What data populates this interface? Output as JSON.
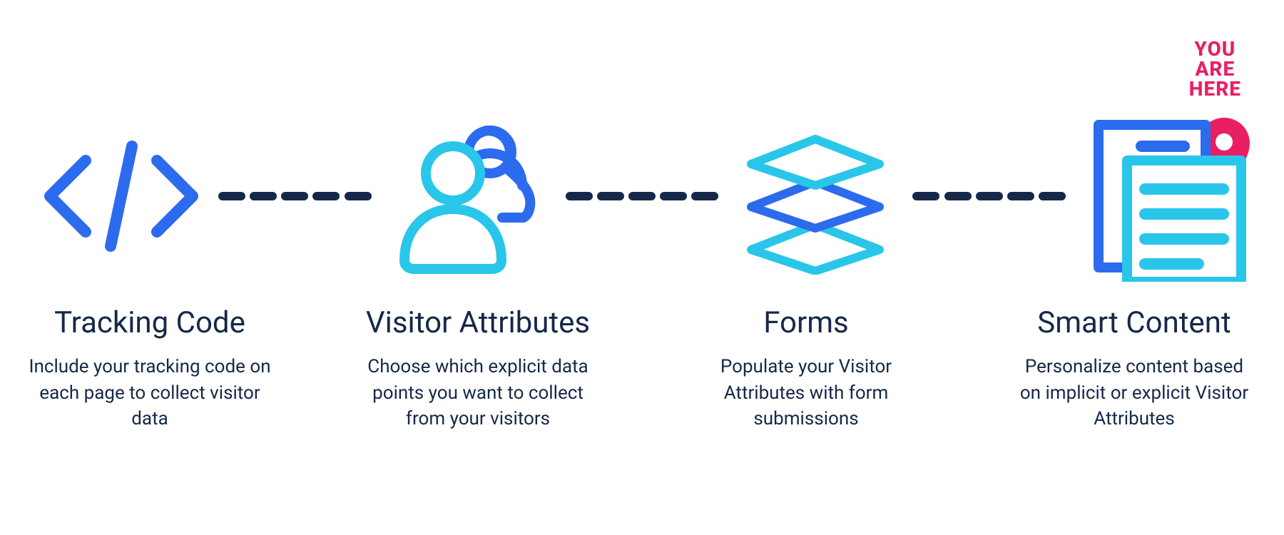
{
  "badge": {
    "line1": "YOU",
    "line2": "ARE",
    "line3": "HERE"
  },
  "steps": [
    {
      "icon": "code-icon",
      "title": "Tracking Code",
      "desc": "Include your tracking code on each page to collect visitor data"
    },
    {
      "icon": "people-icon",
      "title": "Visitor Attributes",
      "desc": "Choose which explicit data points you want to collect from your visitors"
    },
    {
      "icon": "layers-icon",
      "title": "Forms",
      "desc": "Populate your Visitor Attributes with form submissions"
    },
    {
      "icon": "documents-icon",
      "title": "Smart Content",
      "desc": "Personalize content based on implicit or explicit Visitor Attributes"
    }
  ],
  "colors": {
    "navy": "#152849",
    "blue": "#2C6BED",
    "cyan": "#29C6EA",
    "pink": "#E91E63"
  }
}
